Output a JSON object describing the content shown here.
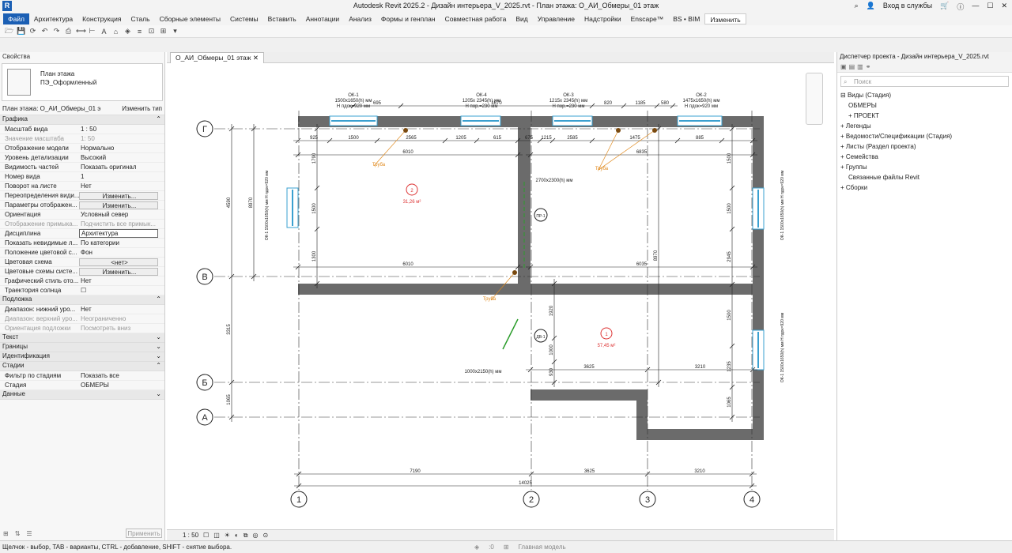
{
  "app": {
    "title": "Autodesk Revit 2025.2 - Дизайн интерьера_V_2025.rvt - План этажа: О_АИ_Обмеры_01 этаж",
    "login": "Вход в службы"
  },
  "ribbon": {
    "tabs": [
      "Файл",
      "Архитектура",
      "Конструкция",
      "Сталь",
      "Сборные элементы",
      "Системы",
      "Вставить",
      "Аннотации",
      "Анализ",
      "Формы и генплан",
      "Совместная работа",
      "Вид",
      "Управление",
      "Надстройки",
      "Enscape™",
      "BS • BIM",
      "Изменить"
    ]
  },
  "properties": {
    "title": "Свойства",
    "type_name1": "План этажа",
    "type_name2": "ПЭ_Оформленный",
    "selector": "План этажа: О_АИ_Обмеры_01 э",
    "edit_type": "Изменить тип",
    "groups": [
      {
        "name": "Графика",
        "rows": [
          {
            "k": "Масштаб вида",
            "v": "1 : 50"
          },
          {
            "k": "Значение масштаба",
            "v": "1:  50",
            "dis": true
          },
          {
            "k": "Отображение модели",
            "v": "Нормально"
          },
          {
            "k": "Уровень детализации",
            "v": "Высокий"
          },
          {
            "k": "Видимость частей",
            "v": "Показать оригинал"
          },
          {
            "k": "Номер вида",
            "v": "1"
          },
          {
            "k": "Поворот на листе",
            "v": "Нет"
          },
          {
            "k": "Переопределения види...",
            "v": "Изменить...",
            "btn": true
          },
          {
            "k": "Параметры отображен...",
            "v": "Изменить...",
            "btn": true
          },
          {
            "k": "Ориентация",
            "v": "Условный север"
          },
          {
            "k": "Отображение примыка...",
            "v": "Подчистить все примык...",
            "dis": true
          },
          {
            "k": "Дисциплина",
            "v": "Архитектура",
            "box": true
          },
          {
            "k": "Показать невидимые л...",
            "v": "По категории"
          },
          {
            "k": "Положение цветовой с...",
            "v": "Фон"
          },
          {
            "k": "Цветовая схема",
            "v": "<нет>",
            "btn": true
          },
          {
            "k": "Цветовые схемы систе...",
            "v": "Изменить...",
            "btn": true
          },
          {
            "k": "Графический стиль ото...",
            "v": "Нет"
          },
          {
            "k": "Траектория солнца",
            "v": "☐"
          }
        ]
      },
      {
        "name": "Подложка",
        "rows": [
          {
            "k": "Диапазон: нижний уро...",
            "v": "Нет"
          },
          {
            "k": "Диапазон: верхний уро...",
            "v": "Неограниченно",
            "dis": true
          },
          {
            "k": "Ориентация подложки",
            "v": "Посмотреть вниз",
            "dis": true
          }
        ]
      },
      {
        "name": "Текст",
        "rows": []
      },
      {
        "name": "Границы",
        "rows": []
      },
      {
        "name": "Идентификация",
        "rows": []
      },
      {
        "name": "Стадии",
        "rows": [
          {
            "k": "Фильтр по стадиям",
            "v": "Показать все"
          },
          {
            "k": "Стадия",
            "v": "ОБМЕРЫ"
          }
        ]
      },
      {
        "name": "Данные",
        "rows": []
      }
    ],
    "apply": "Применить"
  },
  "view": {
    "tab": "О_АИ_Обмеры_01 этаж",
    "scale": "1 : 50",
    "axes_h": [
      "Г",
      "В",
      "Б",
      "А"
    ],
    "axes_v": [
      "1",
      "2",
      "3",
      "4"
    ],
    "dims_top": [
      "925",
      "1500",
      "2565",
      "1205",
      "615",
      "675",
      "1215",
      "2585",
      "1475",
      "885"
    ],
    "dims_top2": [
      "695",
      "1670",
      "820",
      "1185",
      "580"
    ],
    "dims_room2": [
      "6010",
      "6835"
    ],
    "dims_mid": [
      "6010",
      "6035",
      "380"
    ],
    "dims_bottom": [
      "7190",
      "3625",
      "3210"
    ],
    "dims_total": "14025",
    "dims_left": [
      "4590",
      "8970",
      "3315",
      "1065"
    ],
    "dims_inner": [
      "1790",
      "1500",
      "1300",
      "1355",
      "2700",
      "535",
      "195",
      "1920",
      "1000",
      "930",
      "3625",
      "3210",
      "2945",
      "1500",
      "1235",
      "1065",
      "8970",
      "1500"
    ],
    "windows": [
      {
        "n": "ОК-1",
        "s": "1500x1650(h) мм",
        "h": "H пдок=920 мм"
      },
      {
        "n": "ОК-4",
        "s": "1205x 2345(h) мм",
        "h": "H пор.=230 мм"
      },
      {
        "n": "ОК-3",
        "s": "1215x 2345(h) мм",
        "h": "H пор.=230 мм"
      },
      {
        "n": "ОК-2",
        "s": "1475x1650(h) мм",
        "h": "H пдок=920 мм"
      }
    ],
    "side_windows": [
      "ОК-1 1500x1650(h) мм H пдок=920 мм",
      "ОК-1 1500x1650(h) мм H пдок=920 мм",
      "ОК-1 1500x1650(h) мм H пдок=920 мм"
    ],
    "pipe": "Труба",
    "rooms": [
      {
        "num": "2",
        "area": "31,26 м²"
      },
      {
        "num": "1",
        "area": "57,45 м²"
      }
    ],
    "doors": [
      "2700x2300(h) мм",
      "1000x2150(h) мм"
    ],
    "door_tags": [
      "ПР-1",
      "ДВ-1"
    ]
  },
  "browser": {
    "title": "Диспетчер проекта - Дизайн интерьера_V_2025.rvt",
    "search": "Поиск",
    "items": [
      "Виды (Стадия)",
      "ОБМЕРЫ",
      "ПРОЕКТ",
      "Легенды",
      "Ведомости/Спецификации (Стадия)",
      "Листы (Раздел проекта)",
      "Семейства",
      "Группы",
      "Связанные файлы Revit",
      "Сборки"
    ]
  },
  "status": {
    "hint": "Щелчок - выбор, TAB - варианты, CTRL - добавление, SHIFT - снятие выбора.",
    "model": "Главная модель",
    "zero": ":0"
  }
}
